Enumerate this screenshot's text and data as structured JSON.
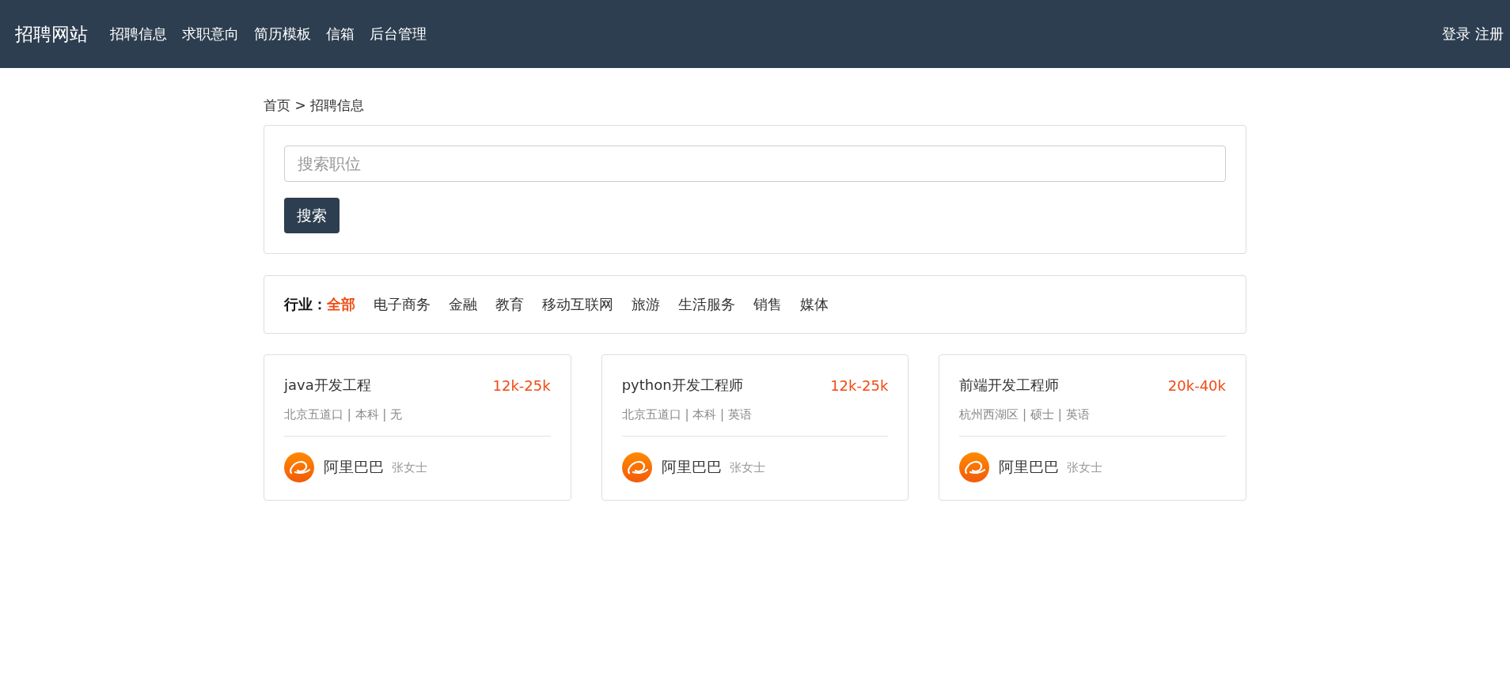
{
  "navbar": {
    "brand": "招聘网站",
    "links": [
      "招聘信息",
      "求职意向",
      "简历模板",
      "信箱",
      "后台管理"
    ],
    "auth": "登录 注册"
  },
  "breadcrumb": "首页 > 招聘信息",
  "search": {
    "placeholder": "搜索职位",
    "button": "搜索"
  },
  "filter": {
    "label": "行业：",
    "options": [
      {
        "label": "全部",
        "selected": true
      },
      {
        "label": "电子商务",
        "selected": false
      },
      {
        "label": "金融",
        "selected": false
      },
      {
        "label": "教育",
        "selected": false
      },
      {
        "label": "移动互联网",
        "selected": false
      },
      {
        "label": "旅游",
        "selected": false
      },
      {
        "label": "生活服务",
        "selected": false
      },
      {
        "label": "销售",
        "selected": false
      },
      {
        "label": "媒体",
        "selected": false
      }
    ]
  },
  "jobs": [
    {
      "title": "java开发工程",
      "salary": "12k-25k",
      "details": "北京五道口 | 本科 | 无",
      "company": "阿里巴巴",
      "contact": "张女士"
    },
    {
      "title": "python开发工程师",
      "salary": "12k-25k",
      "details": "北京五道口 | 本科 | 英语",
      "company": "阿里巴巴",
      "contact": "张女士"
    },
    {
      "title": "前端开发工程师",
      "salary": "20k-40k",
      "details": "杭州西湖区 | 硕士 | 英语",
      "company": "阿里巴巴",
      "contact": "张女士"
    }
  ]
}
